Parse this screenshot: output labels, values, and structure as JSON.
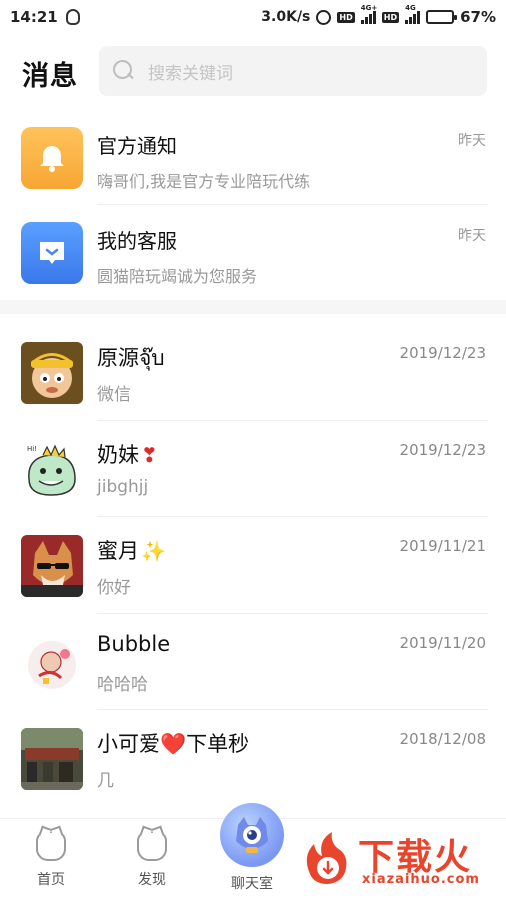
{
  "status_bar": {
    "time": "14:21",
    "speed": "3.0K/s",
    "network_tag_1": "4G+",
    "network_tag_2": "4G",
    "battery_level": 0.67,
    "battery_percent": "67%"
  },
  "header": {
    "title": "消息",
    "search_placeholder": "搜索关键词"
  },
  "system_messages": [
    {
      "title": "官方通知",
      "subtitle": "嗨哥们,我是官方专业陪玩代练",
      "time": "昨天",
      "icon": "bell-icon",
      "color": "#f8ae3e"
    },
    {
      "title": "我的客服",
      "subtitle": "圆猫陪玩竭诚为您服务",
      "time": "昨天",
      "icon": "chat-bubble-icon",
      "color": "#4a8af4"
    }
  ],
  "chats": [
    {
      "name": "原源จุ๊บ",
      "suffix": "",
      "message": "微信",
      "time": "2019/12/23",
      "avatar": "cartoon-boy-avatar"
    },
    {
      "name": "奶妹",
      "suffix": "❣",
      "message": "jibghjj",
      "time": "2019/12/23",
      "avatar": "cartoon-dinosaur-avatar"
    },
    {
      "name": "蜜月",
      "suffix": "✨",
      "message": "你好",
      "time": "2019/11/21",
      "avatar": "dog-sunglasses-avatar"
    },
    {
      "name": "Bubble",
      "suffix": "",
      "message": "哈哈哈",
      "time": "2019/11/20",
      "avatar": "cartoon-sketch-avatar"
    },
    {
      "name": "小可爱❤️下单秒",
      "suffix": "",
      "message": "几",
      "time": "2018/12/08",
      "avatar": "photo-street-avatar"
    }
  ],
  "tab_bar": {
    "tabs": [
      {
        "label": "首页",
        "icon": "home-cat-icon"
      },
      {
        "label": "发现",
        "icon": "discover-cat-icon"
      },
      {
        "label": "聊天室",
        "icon": "chatroom-mascot-icon"
      }
    ]
  },
  "watermark": {
    "text": "下载火",
    "url": "xiazaihuo.com"
  }
}
